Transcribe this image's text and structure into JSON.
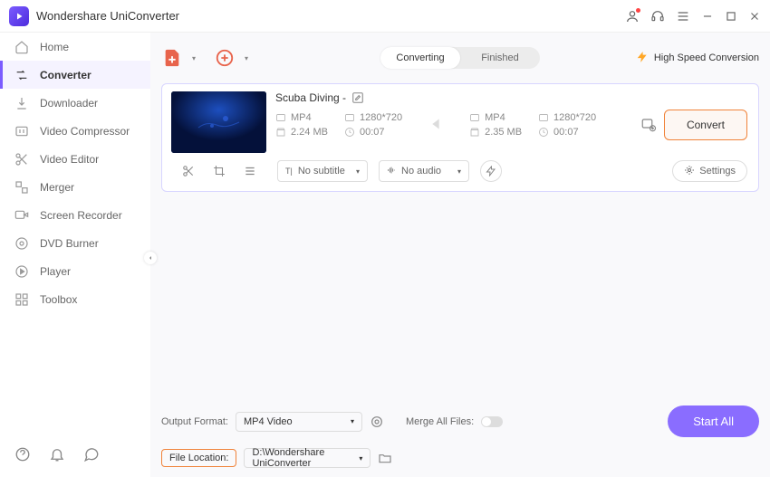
{
  "app": {
    "title": "Wondershare UniConverter"
  },
  "sidebar": {
    "items": [
      {
        "label": "Home"
      },
      {
        "label": "Converter"
      },
      {
        "label": "Downloader"
      },
      {
        "label": "Video Compressor"
      },
      {
        "label": "Video Editor"
      },
      {
        "label": "Merger"
      },
      {
        "label": "Screen Recorder"
      },
      {
        "label": "DVD Burner"
      },
      {
        "label": "Player"
      },
      {
        "label": "Toolbox"
      }
    ]
  },
  "topbar": {
    "tabs": {
      "converting": "Converting",
      "finished": "Finished"
    },
    "high_speed": "High Speed Conversion"
  },
  "file": {
    "title": "Scuba Diving -",
    "src": {
      "format": "MP4",
      "resolution": "1280*720",
      "size": "2.24 MB",
      "duration": "00:07"
    },
    "dst": {
      "format": "MP4",
      "resolution": "1280*720",
      "size": "2.35 MB",
      "duration": "00:07"
    },
    "subtitle": "No subtitle",
    "audio": "No audio",
    "convert_label": "Convert",
    "settings_label": "Settings"
  },
  "bottom": {
    "output_format_label": "Output Format:",
    "output_format_value": "MP4 Video",
    "merge_label": "Merge All Files:",
    "file_location_label": "File Location:",
    "file_location_value": "D:\\Wondershare UniConverter",
    "start_all": "Start All"
  }
}
